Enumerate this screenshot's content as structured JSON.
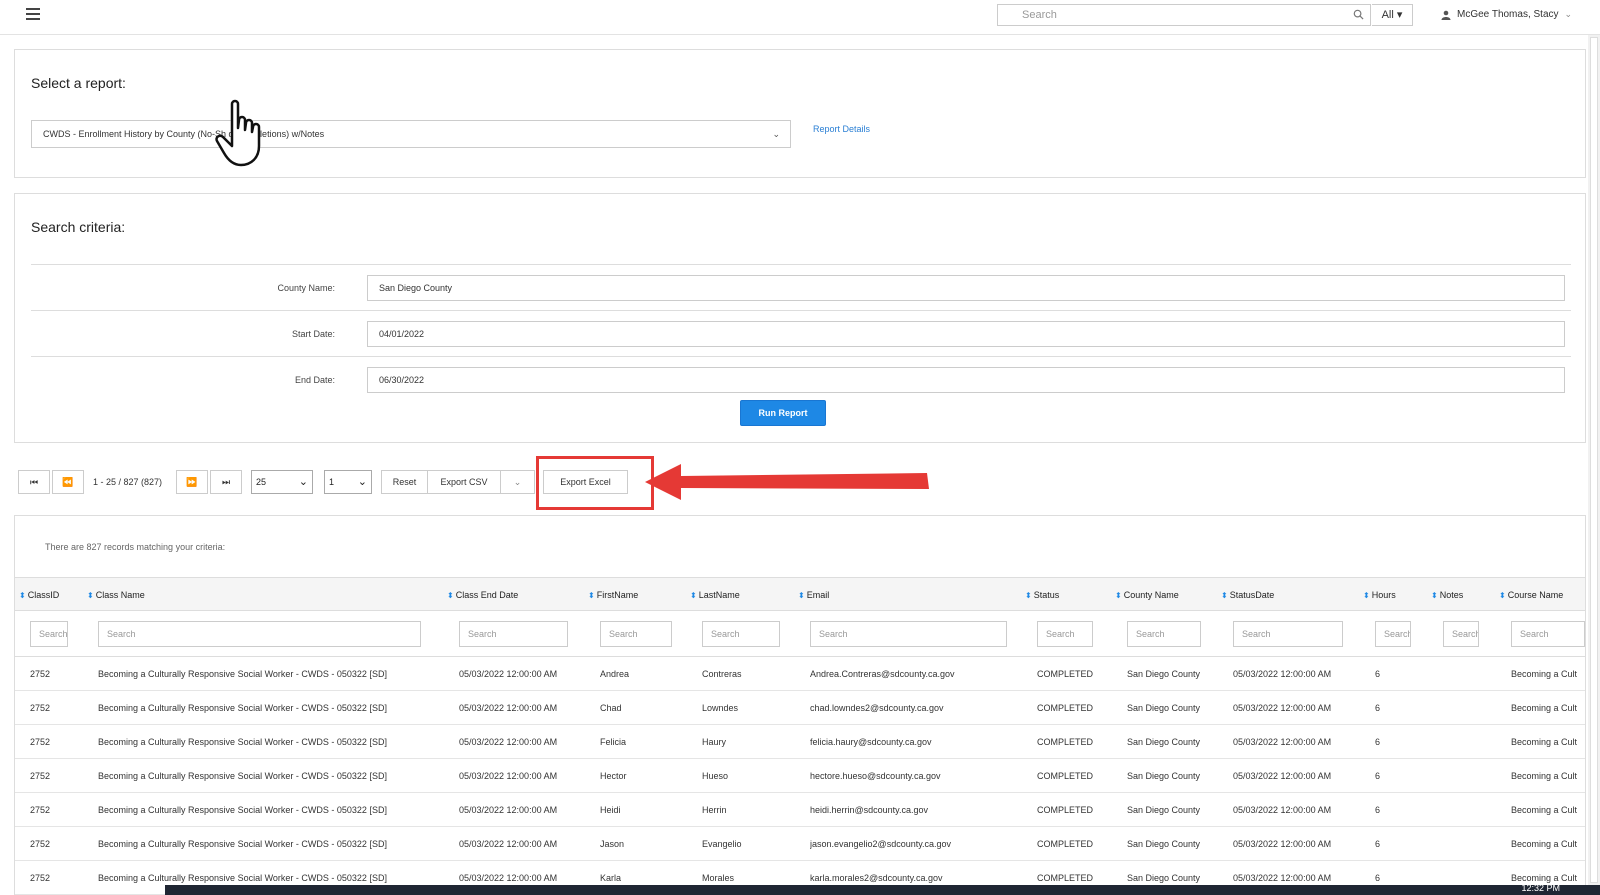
{
  "topbar": {
    "search_placeholder": "Search",
    "scope": "All",
    "user_name": "McGee Thomas, Stacy"
  },
  "report_panel": {
    "title": "Select a report:",
    "selected_report": "CWDS - Enrollment History by County (No-Sh  d Completions) w/Notes",
    "details_link": "Report Details"
  },
  "criteria_panel": {
    "title": "Search criteria:",
    "fields": [
      {
        "label": "County Name:",
        "value": "San Diego County"
      },
      {
        "label": "Start Date:",
        "value": "04/01/2022"
      },
      {
        "label": "End Date:",
        "value": "06/30/2022"
      }
    ],
    "run_label": "Run Report"
  },
  "pager": {
    "range_text": "1 - 25 / 827 (827)",
    "page_size": "25",
    "page": "1",
    "reset_label": "Reset",
    "export_csv_label": "Export CSV",
    "export_excel_label": "Export Excel"
  },
  "results": {
    "summary": "There are 827 records matching your criteria:",
    "filter_placeholder": "Search",
    "columns": [
      "ClassID",
      "Class Name",
      "Class End Date",
      "FirstName",
      "LastName",
      "Email",
      "Status",
      "County Name",
      "StatusDate",
      "Hours",
      "Notes",
      "Course Name"
    ],
    "rows": [
      [
        "2752",
        "Becoming a Culturally Responsive Social Worker - CWDS - 050322 [SD]",
        "05/03/2022 12:00:00 AM",
        "Andrea",
        "Contreras",
        "Andrea.Contreras@sdcounty.ca.gov",
        "COMPLETED",
        "San Diego County",
        "05/03/2022 12:00:00 AM",
        "6",
        "",
        "Becoming a Cult"
      ],
      [
        "2752",
        "Becoming a Culturally Responsive Social Worker - CWDS - 050322 [SD]",
        "05/03/2022 12:00:00 AM",
        "Chad",
        "Lowndes",
        "chad.lowndes2@sdcounty.ca.gov",
        "COMPLETED",
        "San Diego County",
        "05/03/2022 12:00:00 AM",
        "6",
        "",
        "Becoming a Cult"
      ],
      [
        "2752",
        "Becoming a Culturally Responsive Social Worker - CWDS - 050322 [SD]",
        "05/03/2022 12:00:00 AM",
        "Felicia",
        "Haury",
        "felicia.haury@sdcounty.ca.gov",
        "COMPLETED",
        "San Diego County",
        "05/03/2022 12:00:00 AM",
        "6",
        "",
        "Becoming a Cult"
      ],
      [
        "2752",
        "Becoming a Culturally Responsive Social Worker - CWDS - 050322 [SD]",
        "05/03/2022 12:00:00 AM",
        "Hector",
        "Hueso",
        "hectore.hueso@sdcounty.ca.gov",
        "COMPLETED",
        "San Diego County",
        "05/03/2022 12:00:00 AM",
        "6",
        "",
        "Becoming a Cult"
      ],
      [
        "2752",
        "Becoming a Culturally Responsive Social Worker - CWDS - 050322 [SD]",
        "05/03/2022 12:00:00 AM",
        "Heidi",
        "Herrin",
        "heidi.herrin@sdcounty.ca.gov",
        "COMPLETED",
        "San Diego County",
        "05/03/2022 12:00:00 AM",
        "6",
        "",
        "Becoming a Cult"
      ],
      [
        "2752",
        "Becoming a Culturally Responsive Social Worker - CWDS - 050322 [SD]",
        "05/03/2022 12:00:00 AM",
        "Jason",
        "Evangelio",
        "jason.evangelio2@sdcounty.ca.gov",
        "COMPLETED",
        "San Diego County",
        "05/03/2022 12:00:00 AM",
        "6",
        "",
        "Becoming a Cult"
      ],
      [
        "2752",
        "Becoming a Culturally Responsive Social Worker - CWDS - 050322 [SD]",
        "05/03/2022 12:00:00 AM",
        "Karla",
        "Morales",
        "karla.morales2@sdcounty.ca.gov",
        "COMPLETED",
        "San Diego County",
        "05/03/2022 12:00:00 AM",
        "6",
        "",
        "Becoming a Cult"
      ]
    ]
  },
  "taskbar": {
    "time": "12:32 PM"
  },
  "colors": {
    "accent": "#1e88e5",
    "highlight": "#e53935"
  }
}
